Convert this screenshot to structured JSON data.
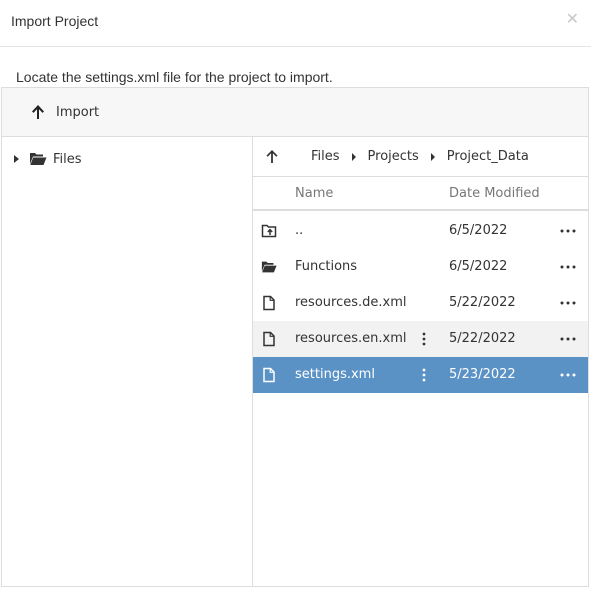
{
  "dialog": {
    "title": "Import Project",
    "close_icon": "close-icon",
    "instruction": "Locate the settings.xml file for the project to import."
  },
  "toolbar": {
    "import_label": "Import",
    "import_icon": "arrow-up-icon"
  },
  "tree": {
    "root_label": "Files",
    "root_icon": "folder-open-icon"
  },
  "breadcrumb": {
    "up_icon": "arrow-up-icon",
    "items": [
      "Files",
      "Projects",
      "Project_Data"
    ]
  },
  "grid": {
    "columns": {
      "name": "Name",
      "date": "Date Modified"
    },
    "rows": [
      {
        "icon": "folder-up-icon",
        "name": "..",
        "date": "6/5/2022",
        "state": "normal"
      },
      {
        "icon": "folder-open-icon",
        "name": "Functions",
        "date": "6/5/2022",
        "state": "normal"
      },
      {
        "icon": "file-icon",
        "name": "resources.de.xml",
        "date": "5/22/2022",
        "state": "normal"
      },
      {
        "icon": "file-icon",
        "name": "resources.en.xml",
        "date": "5/22/2022",
        "state": "hover"
      },
      {
        "icon": "file-icon",
        "name": "settings.xml",
        "date": "5/23/2022",
        "state": "selected"
      }
    ]
  },
  "colors": {
    "selected_row": "#5b92c6",
    "hover_row": "#f2f2f2",
    "toolbar_bg": "#f7f7f7",
    "border": "#dddddd"
  }
}
